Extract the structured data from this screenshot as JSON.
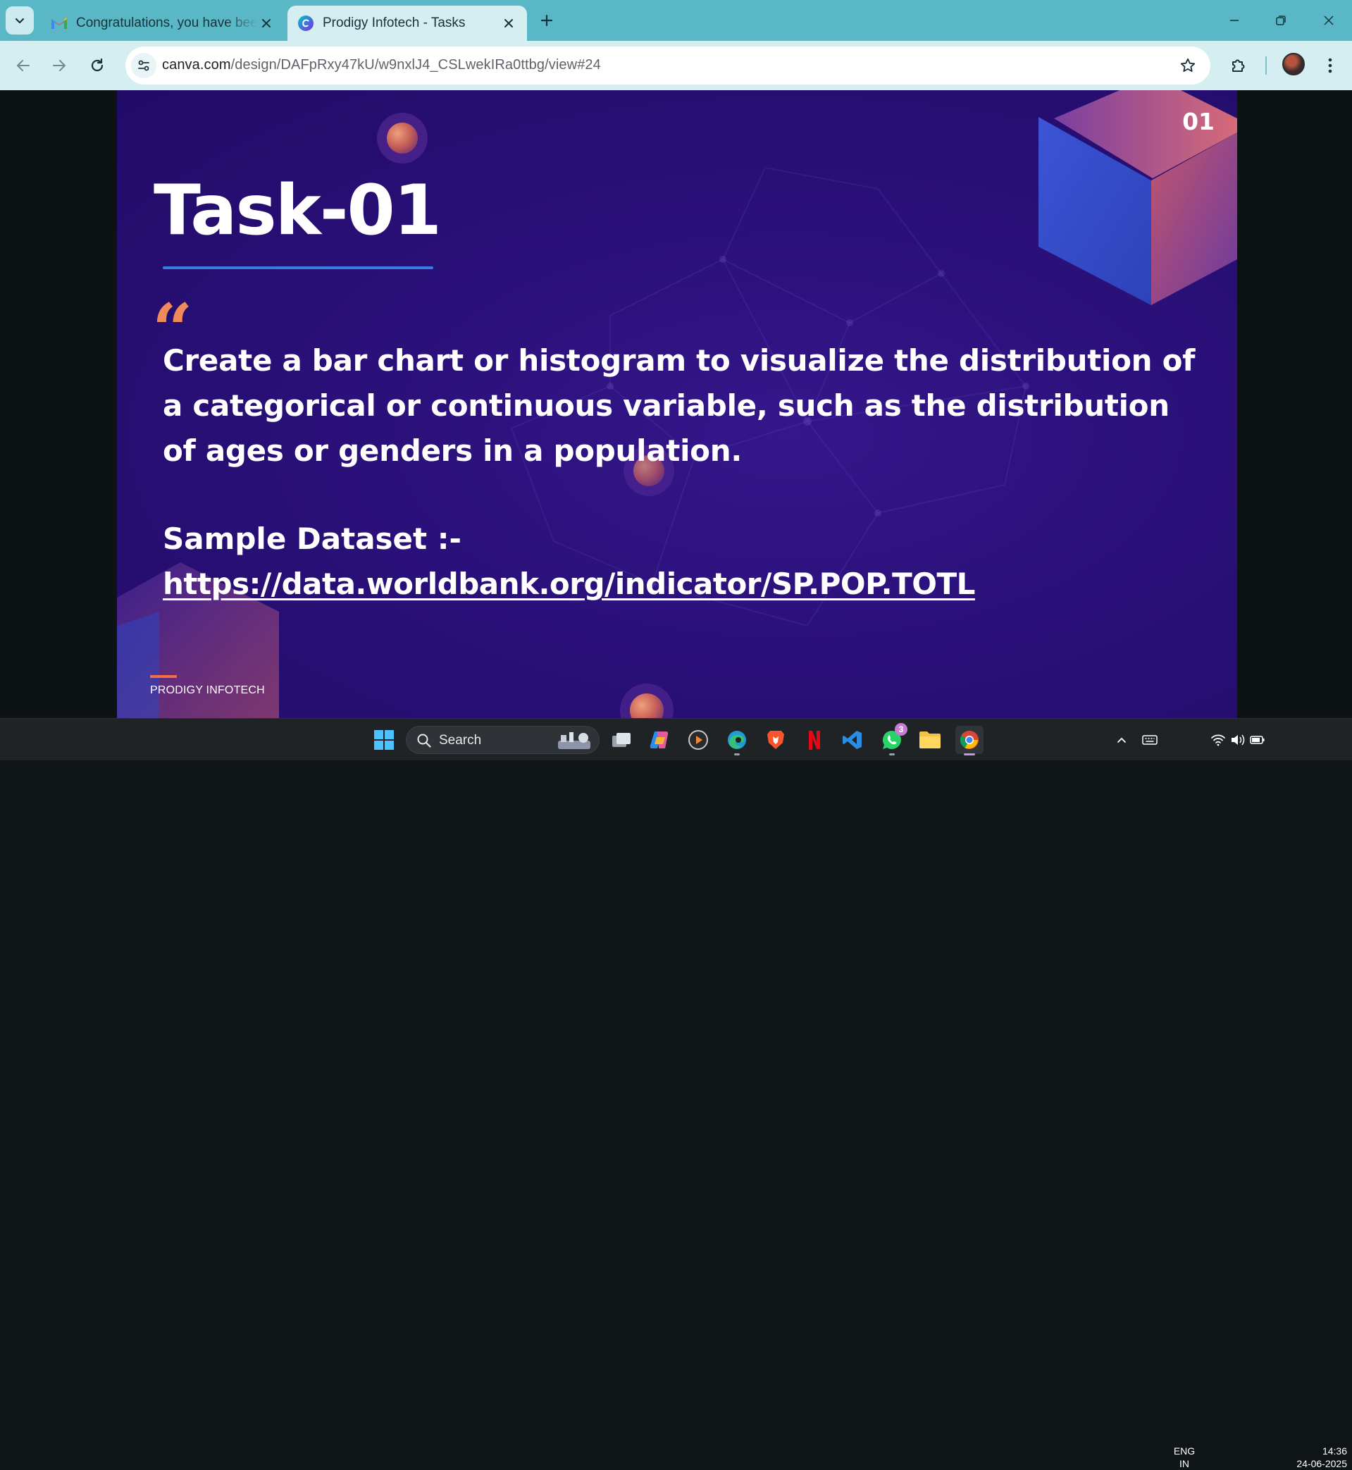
{
  "browser": {
    "tabs": [
      {
        "title": "Congratulations, you have been",
        "favicon": "gmail-icon",
        "active": false
      },
      {
        "title": "Prodigy Infotech - Tasks",
        "favicon": "canva-icon",
        "active": true
      }
    ],
    "url": {
      "domain": "canva.com",
      "path": "/design/DAFpRxy47kU/w9nxlJ4_CSLwekIRa0ttbg/view#24"
    }
  },
  "slide": {
    "number": "01",
    "title": "Task-01",
    "description": "Create a bar chart or histogram to visualize the distribution of a categorical or continuous variable, such as the distribution of ages or genders in a population.",
    "dataset_label": "Sample Dataset :-",
    "dataset_link": "https://data.worldbank.org/indicator/SP.POP.TOTL",
    "brand": "PRODIGY INFOTECH",
    "colors": {
      "background": "#2a1079",
      "accent_orange": "#f08a5a",
      "accent_blue": "#3a7dde"
    }
  },
  "taskbar": {
    "search_label": "Search",
    "whatsapp_badge": "3",
    "language": {
      "line1": "ENG",
      "line2": "IN"
    },
    "clock": {
      "time": "14:36",
      "date": "24-06-2025"
    }
  }
}
